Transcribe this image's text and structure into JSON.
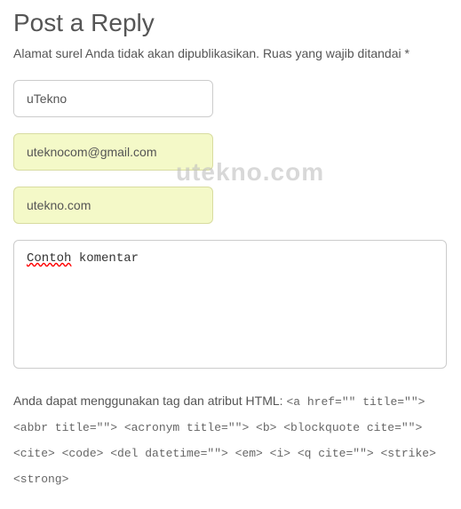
{
  "heading": "Post a Reply",
  "description": "Alamat surel Anda tidak akan dipublikasikan. Ruas yang wajib ditandai *",
  "fields": {
    "name": "uTekno",
    "email": "uteknocom@gmail.com",
    "website": "utekno.com"
  },
  "comment": {
    "word1": "Contoh",
    "word2": "komentar"
  },
  "allowed_intro": "Anda dapat menggunakan tag dan atribut HTML: ",
  "allowed_tags": "<a href=\"\" title=\"\"> <abbr title=\"\"> <acronym title=\"\"> <b> <blockquote cite=\"\"> <cite> <code> <del datetime=\"\"> <em> <i> <q cite=\"\"> <strike> <strong>",
  "watermark": "utekno.com"
}
